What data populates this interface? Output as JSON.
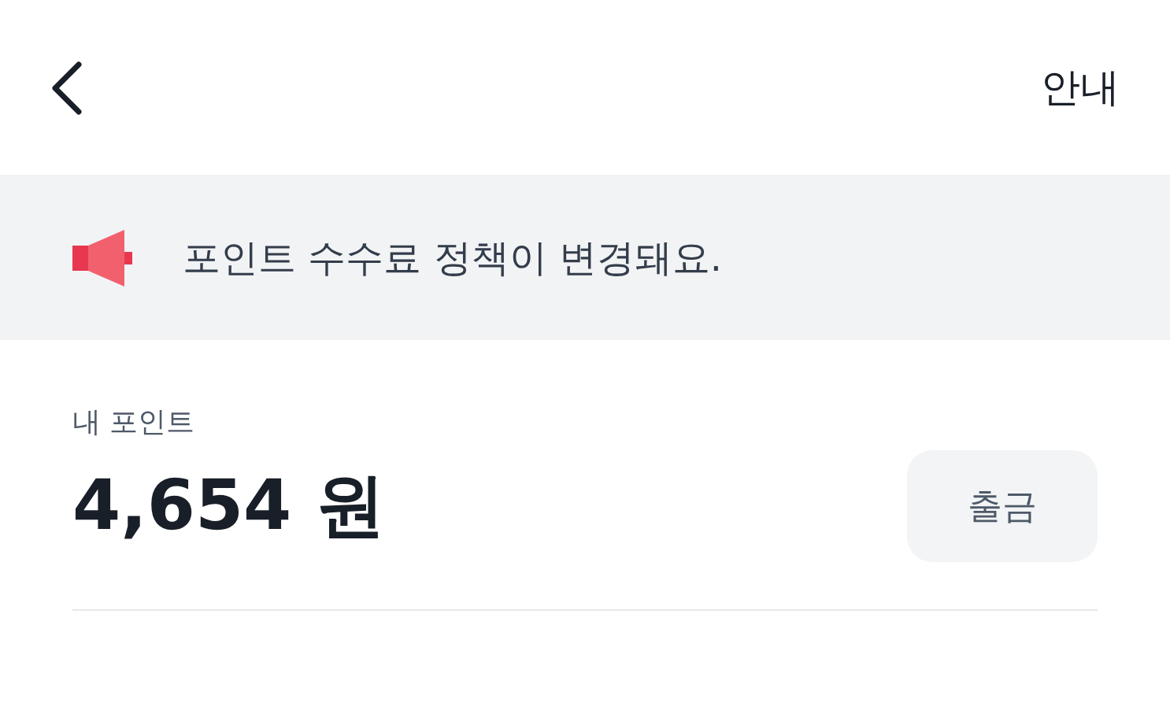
{
  "header": {
    "action": "안내"
  },
  "notice": {
    "text": "포인트 수수료 정책이 변경돼요."
  },
  "points": {
    "label": "내 포인트",
    "amount": "4,654 원",
    "button": "출금"
  }
}
